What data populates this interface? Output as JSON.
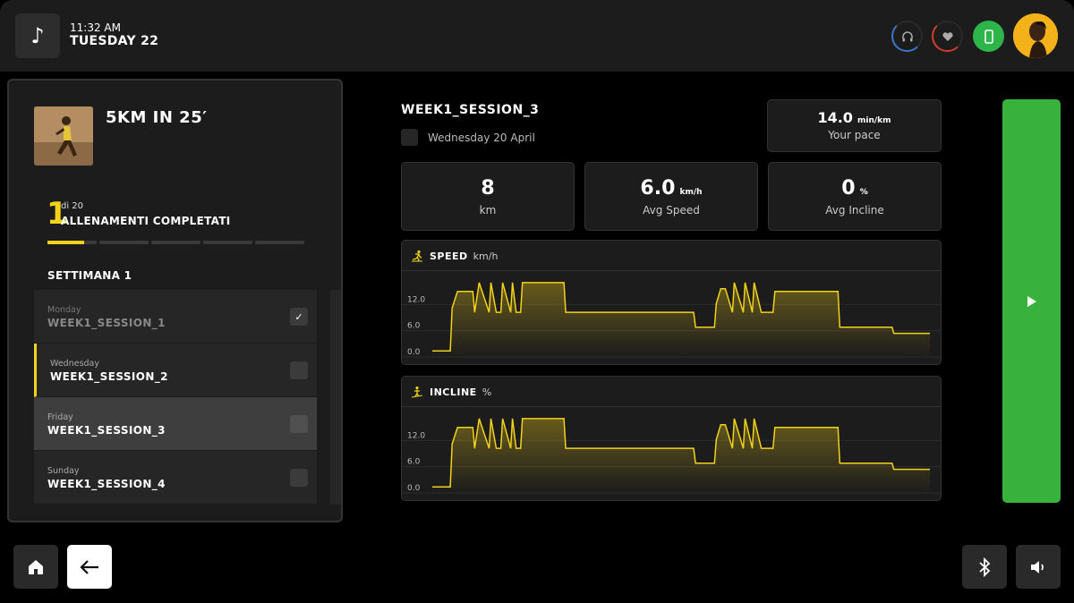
{
  "topbar": {
    "time": "11:32 AM",
    "date": "TUESDAY 22",
    "icons": [
      "music-note-icon",
      "headphones-icon",
      "heart-icon",
      "phone-icon",
      "avatar"
    ]
  },
  "program": {
    "title": "5KM IN 25′",
    "completed": "1",
    "of_total": "di 20",
    "completed_label": "ALLENAMENTI COMPLETATI",
    "segments_progress": [
      0.75,
      0,
      0,
      0,
      0
    ],
    "week_title": "SETTIMANA 1",
    "sessions": [
      {
        "day": "Monday",
        "name": "WEEK1_SESSION_1",
        "done": true
      },
      {
        "day": "Wednesday",
        "name": "WEEK1_SESSION_2",
        "done": false
      },
      {
        "day": "Friday",
        "name": "WEEK1_SESSION_3",
        "done": false
      },
      {
        "day": "Sunday",
        "name": "WEEK1_SESSION_4",
        "done": false
      }
    ]
  },
  "session": {
    "title": "WEEK1_SESSION_3",
    "date": "Wednesday 20 April",
    "pace": {
      "value": "14.0",
      "unit": "min/km",
      "label": "Your pace"
    },
    "distance": {
      "value": "8",
      "unit": "",
      "label": "km"
    },
    "avg_speed": {
      "value": "6.0",
      "unit": "km/h",
      "label": "Avg Speed"
    },
    "avg_incline": {
      "value": "0",
      "unit": "%",
      "label": "Avg Incline"
    }
  },
  "charts": {
    "speed": {
      "title": "SPEED",
      "unit": "km/h",
      "icon": "runner-icon"
    },
    "incline": {
      "title": "INCLINE",
      "unit": "%",
      "icon": "incline-runner-icon"
    },
    "accent": "#f2d21a"
  },
  "chart_data": [
    {
      "type": "line",
      "title": "SPEED",
      "ylabel": "km/h",
      "yticks": [
        "0.0",
        "6.0",
        "12.0"
      ],
      "ylim": [
        0,
        18
      ],
      "x": [
        0,
        20,
        22,
        28,
        45,
        47,
        52,
        63,
        65,
        71,
        76,
        78,
        87,
        89,
        93,
        98,
        100,
        146,
        148,
        290,
        292,
        313,
        315,
        320,
        325,
        333,
        335,
        345,
        347,
        355,
        357,
        365,
        367,
        378,
        380,
        395,
        397,
        450,
        452,
        510,
        512,
        552
      ],
      "y": [
        1.4,
        1.4,
        11.2,
        15.0,
        15.0,
        10.2,
        17.0,
        10.2,
        17.0,
        10.2,
        10.2,
        17.0,
        10.2,
        17.0,
        10.2,
        10.2,
        17.0,
        17.0,
        10.2,
        10.2,
        6.8,
        6.8,
        12.2,
        15.6,
        15.6,
        10.2,
        17.0,
        10.2,
        17.0,
        10.2,
        17.0,
        10.2,
        10.2,
        10.2,
        15.0,
        15.0,
        15.0,
        15.0,
        6.8,
        6.8,
        5.4,
        5.4
      ]
    },
    {
      "type": "line",
      "title": "INCLINE",
      "ylabel": "%",
      "yticks": [
        "0.0",
        "6.0",
        "12.0"
      ],
      "ylim": [
        0,
        18
      ],
      "x": [
        0,
        20,
        22,
        28,
        45,
        47,
        52,
        63,
        65,
        71,
        76,
        78,
        87,
        89,
        93,
        98,
        100,
        146,
        148,
        290,
        292,
        313,
        315,
        320,
        325,
        333,
        335,
        345,
        347,
        355,
        357,
        365,
        367,
        378,
        380,
        395,
        397,
        450,
        452,
        510,
        512,
        552
      ],
      "y": [
        1.4,
        1.4,
        11.2,
        15.0,
        15.0,
        10.2,
        17.0,
        10.2,
        17.0,
        10.2,
        10.2,
        17.0,
        10.2,
        17.0,
        10.2,
        10.2,
        17.0,
        17.0,
        10.2,
        10.2,
        6.8,
        6.8,
        12.2,
        15.6,
        15.6,
        10.2,
        17.0,
        10.2,
        17.0,
        10.2,
        17.0,
        10.2,
        10.2,
        10.2,
        15.0,
        15.0,
        15.0,
        15.0,
        6.8,
        6.8,
        5.4,
        5.4
      ]
    }
  ],
  "bottom": {
    "home_icon": "home-icon",
    "back_icon": "arrow-left-icon",
    "bluetooth_icon": "bluetooth-icon",
    "volume_icon": "volume-icon"
  },
  "colors": {
    "accent": "#f2d21a",
    "play": "#38b23c",
    "phone": "#2db54a",
    "headphones_ring": "#3a76c9",
    "heart_ring": "#d33b2c"
  }
}
